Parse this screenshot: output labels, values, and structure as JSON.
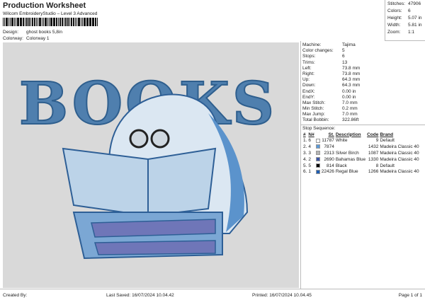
{
  "header": {
    "title": "Production Worksheet",
    "subtitle": "Wilcom EmbroideryStudio – Level 3 Advanced",
    "design_label": "Design:",
    "design_value": "ghost books 5,8in",
    "colorway_label": "Colorway:",
    "colorway_value": "Colorway 1"
  },
  "stats": [
    {
      "label": "Stitches:",
      "value": "47906"
    },
    {
      "label": "Colors:",
      "value": "6"
    },
    {
      "label": "Height:",
      "value": "5.07 in"
    },
    {
      "label": "Width:",
      "value": "5.81 in"
    },
    {
      "label": "Zoom:",
      "value": "1:1"
    }
  ],
  "info": [
    {
      "label": "Machine:",
      "value": "Tajima"
    },
    {
      "label": "Color changes:",
      "value": "5"
    },
    {
      "label": "Stops:",
      "value": "6"
    },
    {
      "label": "Trims:",
      "value": "13"
    },
    {
      "label": "Left:",
      "value": "73.8 mm"
    },
    {
      "label": "Right:",
      "value": "73.8 mm"
    },
    {
      "label": "Up:",
      "value": "64.3 mm"
    },
    {
      "label": "Down:",
      "value": "64.3 mm"
    },
    {
      "label": "EndX:",
      "value": "0.00 in"
    },
    {
      "label": "EndY:",
      "value": "0.00 in"
    },
    {
      "label": "Max Stitch:",
      "value": "7.0 mm"
    },
    {
      "label": "Min Stitch:",
      "value": "0.2 mm"
    },
    {
      "label": "Max Jump:",
      "value": "7.0 mm"
    },
    {
      "label": "Total Bobbin:",
      "value": "322.86ft"
    }
  ],
  "stop_sequence": {
    "title": "Stop Sequence:",
    "headers": [
      "#",
      "N#",
      "St.",
      "Description",
      "Code",
      "Brand"
    ],
    "rows": [
      {
        "num": "1.",
        "n": "6",
        "color": "#ffffff",
        "st": "11787",
        "desc": "White",
        "code": "9",
        "brand": "Default"
      },
      {
        "num": "2.",
        "n": "4",
        "color": "#5c9ad8",
        "st": "7874",
        "desc": "",
        "code": "1432",
        "brand": "Madeira Classic 40"
      },
      {
        "num": "3.",
        "n": "3",
        "color": "#b5b5b5",
        "st": "2313",
        "desc": "Silver Birch",
        "code": "1087",
        "brand": "Madeira Classic 40"
      },
      {
        "num": "4.",
        "n": "2",
        "color": "#3c56a6",
        "st": "2690",
        "desc": "Bahamas Blue",
        "code": "1330",
        "brand": "Madeira Classic 40"
      },
      {
        "num": "5.",
        "n": "5",
        "color": "#000000",
        "st": "814",
        "desc": "Black",
        "code": "8",
        "brand": "Default"
      },
      {
        "num": "6.",
        "n": "1",
        "color": "#1e5db3",
        "st": "22426",
        "desc": "Regal Blue",
        "code": "1266",
        "brand": "Madeira Classic 40"
      }
    ]
  },
  "footer": {
    "created": "Created By:",
    "saved": "Last Saved: 16/07/2024 10.04.42",
    "printed": "Printed: 16/07/2024 10.04.45",
    "page": "Page 1 of 1"
  },
  "design": {
    "text": "BOOKS"
  }
}
